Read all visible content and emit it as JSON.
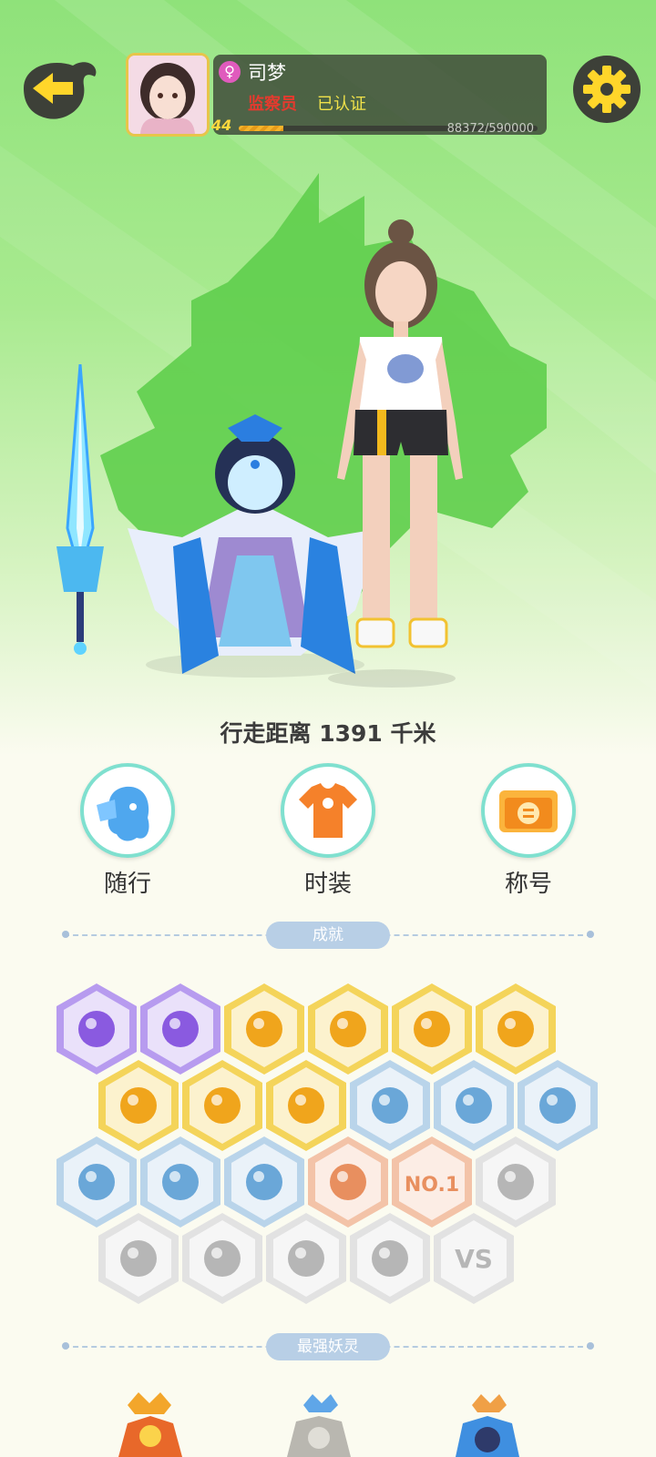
{
  "profile": {
    "gender_symbol": "♀",
    "name": "司梦",
    "role": "监察员",
    "verified": "已认证",
    "level": "44",
    "xp_text": "88372/590000",
    "xp_fraction": 0.15
  },
  "distance_text": "行走距离 1391 千米",
  "menu": {
    "follow_label": "随行",
    "fashion_label": "时装",
    "title_label": "称号"
  },
  "sections": {
    "achievements": "成就",
    "strongest": "最强妖灵"
  },
  "achievement_badges": [
    {
      "icon": "purple-devil-icon",
      "tier": "purple"
    },
    {
      "icon": "purple-cat-icon",
      "tier": "purple"
    },
    {
      "icon": "sneaker-icon",
      "tier": "gold"
    },
    {
      "icon": "sun-orb-icon",
      "tier": "gold"
    },
    {
      "icon": "gold-orb-icon",
      "tier": "gold"
    },
    {
      "icon": "yinyang-comet-icon",
      "tier": "gold"
    },
    {
      "icon": "yinyang-card-icon",
      "tier": "gold"
    },
    {
      "icon": "dancing-fox-icon",
      "tier": "gold"
    },
    {
      "icon": "open-book-icon",
      "tier": "gold"
    },
    {
      "icon": "moon-icon",
      "tier": "blue"
    },
    {
      "icon": "crystal-icon",
      "tier": "blue"
    },
    {
      "icon": "spirit-statue-icon",
      "tier": "blue"
    },
    {
      "icon": "stroller-icon",
      "tier": "blue"
    },
    {
      "icon": "portal-icon",
      "tier": "blue"
    },
    {
      "icon": "monster-icon",
      "tier": "blue"
    },
    {
      "icon": "twin-pets-icon",
      "tier": "orange"
    },
    {
      "icon": "no1-icon",
      "tier": "orange",
      "text": "NO.1"
    },
    {
      "icon": "mask-icon",
      "tier": "gray"
    },
    {
      "icon": "crossed-swords-icon",
      "tier": "gray"
    },
    {
      "icon": "cat-pair-icon",
      "tier": "gray"
    },
    {
      "icon": "angry-bag-icon",
      "tier": "gray"
    },
    {
      "icon": "cat-list-icon",
      "tier": "gray"
    },
    {
      "icon": "vs-icon",
      "tier": "gray",
      "text": "VS"
    }
  ],
  "colors": {
    "purple": "#b79bef",
    "gold": "#f4d45a",
    "blue": "#b9d4ea",
    "orange": "#f3c3a8",
    "gray": "#e2e2e2",
    "accent_teal": "#7fe0cf",
    "hero_green": "#8fe27a"
  }
}
